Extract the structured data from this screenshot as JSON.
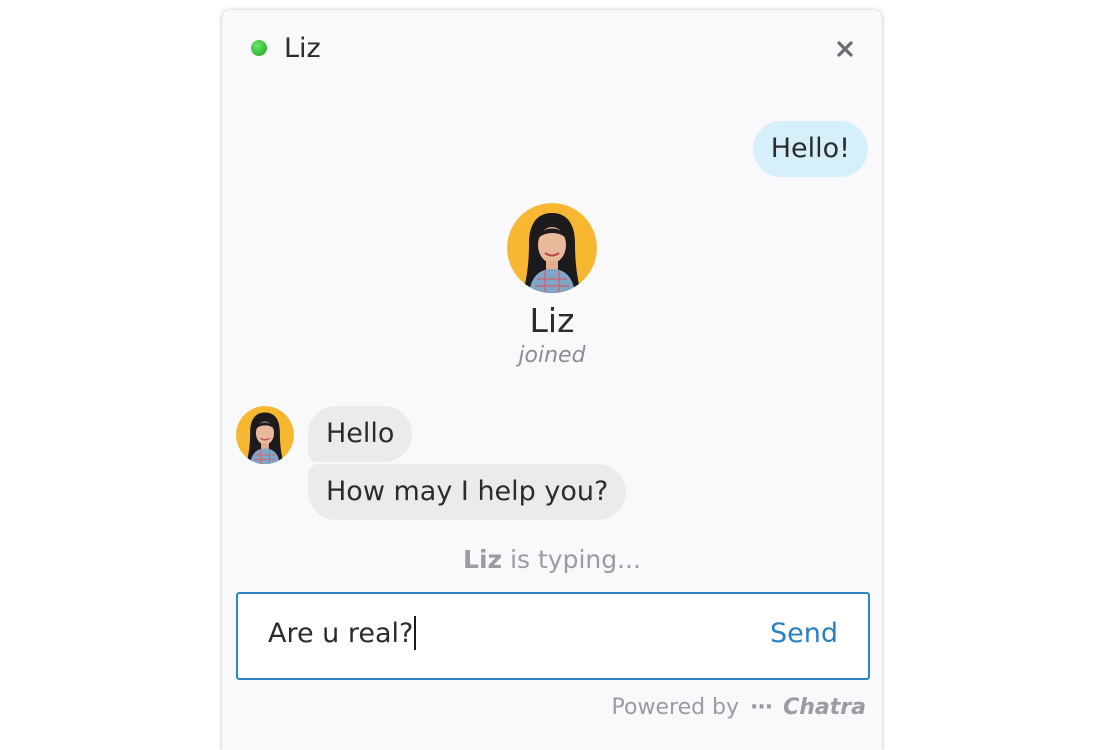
{
  "header": {
    "agent_name": "Liz",
    "status": "online",
    "status_color": "#3cc13f",
    "close_icon": "close-icon"
  },
  "messages": {
    "outgoing": [
      {
        "text": "Hello!"
      }
    ],
    "incoming": [
      {
        "text": "Hello"
      },
      {
        "text": "How may I help you?"
      }
    ]
  },
  "join_notice": {
    "name": "Liz",
    "status": "joined"
  },
  "typing": {
    "name": "Liz",
    "text": "is typing..."
  },
  "composer": {
    "value": "Are u real?",
    "send_label": "Send",
    "border_color": "#2d87c0"
  },
  "footer": {
    "powered_by": "Powered by",
    "dots": "···",
    "brand": "Chatra"
  },
  "colors": {
    "outgoing_bubble": "#d6f0fb",
    "incoming_bubble": "#ebebee",
    "accent": "#2a7fbf",
    "avatar_bg": "#f7b731"
  }
}
